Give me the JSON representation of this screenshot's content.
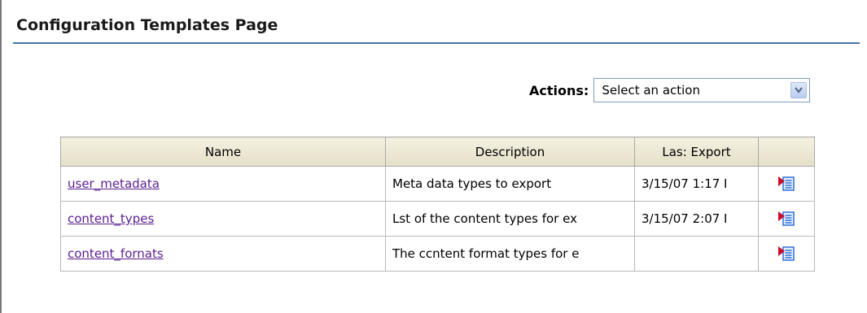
{
  "page": {
    "title": "Configuration Templates Page"
  },
  "actions": {
    "label": "Actions:",
    "selected": "Select an action"
  },
  "table": {
    "columns": [
      "Name",
      "Description",
      "Las: Export",
      ""
    ],
    "rows": [
      {
        "name": "user_metadata",
        "description": "Meta data types to export",
        "last_export": "3/15/07 1:17 I",
        "icon": "export-doc-icon"
      },
      {
        "name": "content_types",
        "description": "Lst of the content types for ex",
        "last_export": "3/15/07 2:07 I",
        "icon": "export-doc-icon"
      },
      {
        "name": "content_fornats",
        "description": "The ccntent format types for e",
        "last_export": "",
        "icon": "export-doc-icon"
      }
    ]
  },
  "colors": {
    "title_rule": "#4a74a8",
    "link": "#5b1e8f",
    "header_bg": "#e4dfc6",
    "icon_red": "#c8102e",
    "icon_blue": "#2f6fd6"
  }
}
